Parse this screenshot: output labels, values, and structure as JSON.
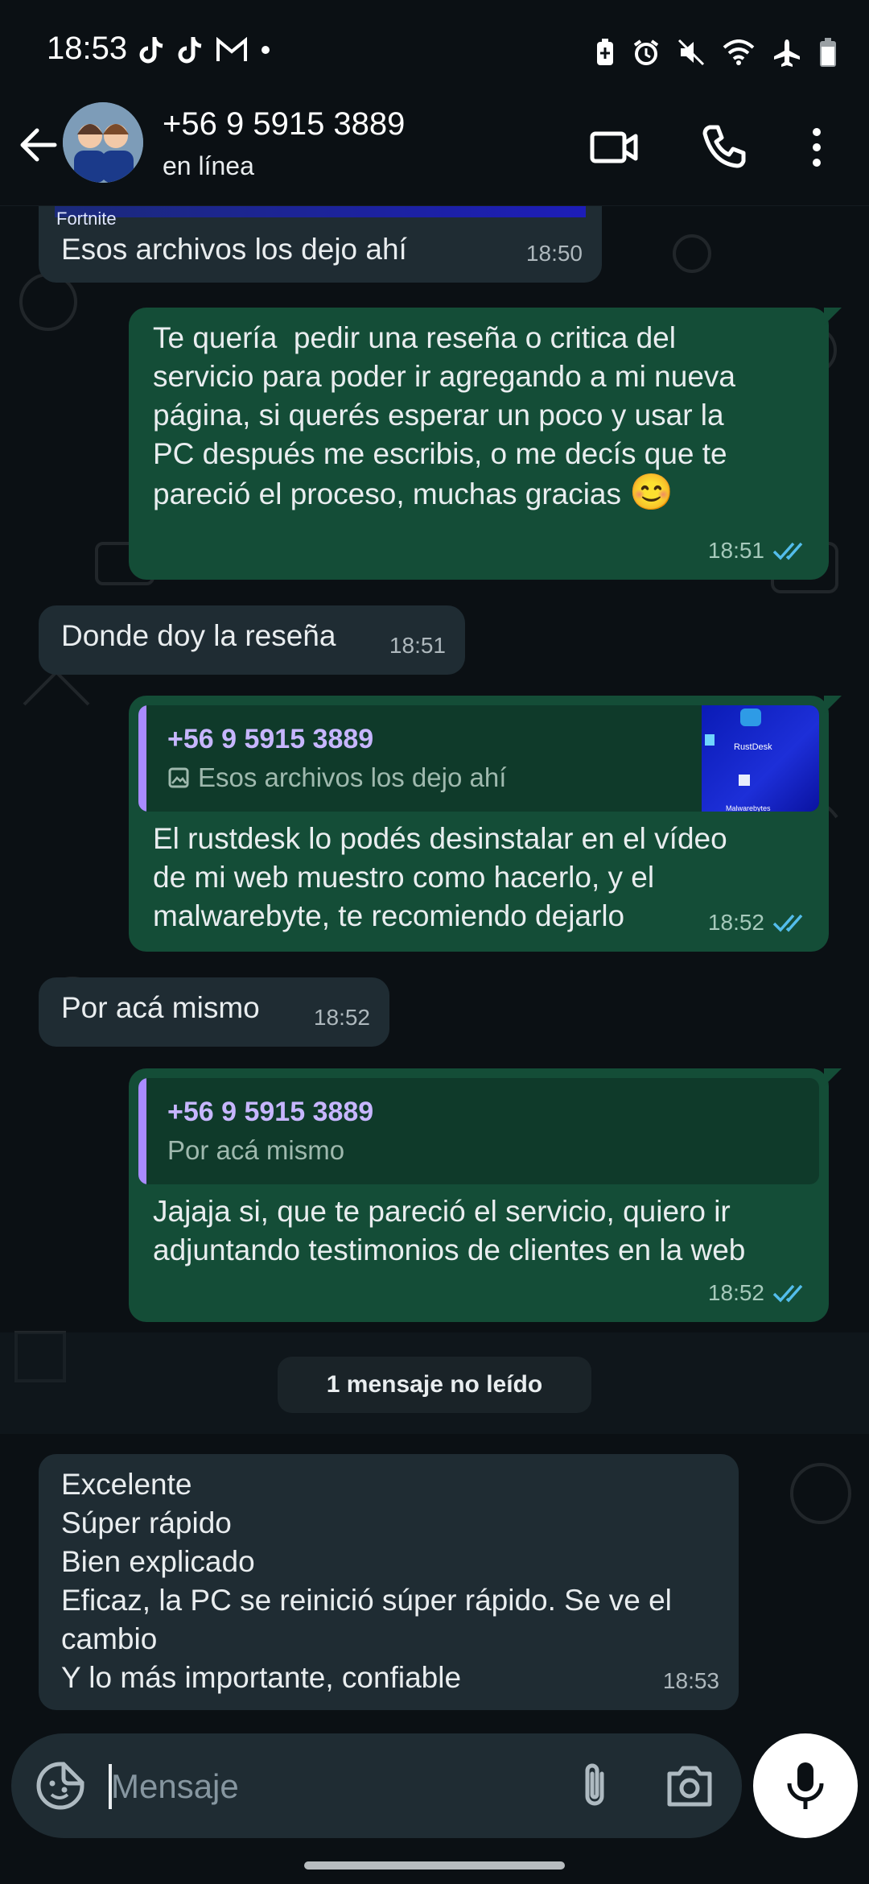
{
  "status_bar": {
    "time": "18:53",
    "left_icons": [
      "tiktok-icon",
      "tiktok-icon",
      "gmail-icon",
      "dot-icon"
    ],
    "right_icons": [
      "battery-saver-icon",
      "alarm-icon",
      "mute-icon",
      "wifi-icon",
      "airplane-icon",
      "battery-icon"
    ]
  },
  "header": {
    "contact_name": "+56 9 5915 3889",
    "status": "en línea"
  },
  "top_fragment": {
    "label": "Fortnite"
  },
  "messages": [
    {
      "direction": "in",
      "text": "Esos archivos los dejo ahí",
      "time": "18:50"
    },
    {
      "direction": "out",
      "text": "Te quería  pedir una reseña o critica del\nservicio para poder ir agregando a mi nueva\npágina, si querés esperar un poco y usar la\nPC después me escribis, o me decís que te\npareció el proceso, muchas gracias",
      "emoji": "😊",
      "time": "18:51",
      "status": "read"
    },
    {
      "direction": "in",
      "text": "Donde doy la reseña",
      "time": "18:51"
    },
    {
      "direction": "out",
      "reply_to": {
        "name": "+56 9 5915 3889",
        "text": "Esos archivos los dejo ahí"
      },
      "text": "El rustdesk lo podés desinstalar en el vídeo\nde mi web muestro como hacerlo, y el\nmalwarebyte, te recomiendo dejarlo",
      "time": "18:52",
      "status": "read"
    },
    {
      "direction": "in",
      "text": "Por acá mismo",
      "time": "18:52"
    },
    {
      "direction": "out",
      "reply_to": {
        "name": "+56 9 5915 3889",
        "text": "Por acá mismo"
      },
      "text": "Jajaja si, que te pareció el servicio, quiero ir\nadjuntando testimonios de clientes en la web",
      "time": "18:52",
      "status": "read"
    },
    {
      "direction": "in",
      "text": "Excelente\nSúper rápido\nBien explicado\nEficaz, la PC se reinició súper rápido. Se ve el\ncambio\nY lo más importante, confiable",
      "time": "18:53"
    }
  ],
  "unread_divider": "1 mensaje no leído",
  "thumbnail_labels": [
    "RustDesk",
    "Malwarebytes"
  ],
  "composer": {
    "placeholder": "Mensaje"
  },
  "colors": {
    "background": "#0b1014",
    "incoming_bubble": "#1f2c33",
    "outgoing_bubble": "#144d37",
    "read_ticks": "#53bdeb",
    "reply_name": "#c7b6ff"
  }
}
